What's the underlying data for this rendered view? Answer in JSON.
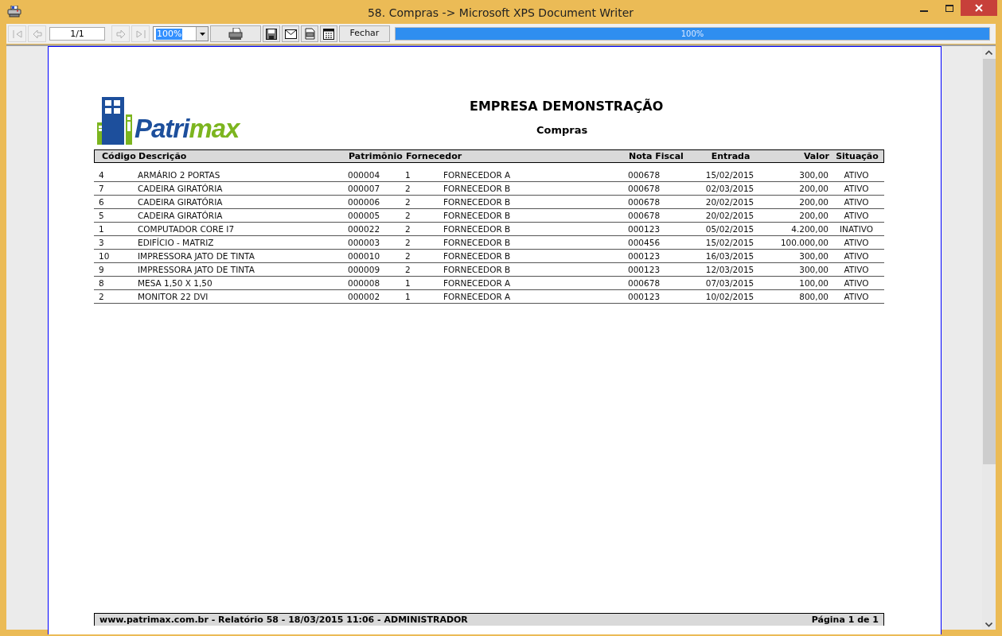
{
  "window": {
    "title": "58. Compras -> Microsoft XPS Document Writer"
  },
  "toolbar": {
    "nav_buttons": [
      {
        "kind": "first",
        "disabled": true
      },
      {
        "kind": "prev",
        "disabled": true
      }
    ],
    "page_field": "1/1",
    "nav_buttons_after": [
      {
        "kind": "next",
        "disabled": true
      },
      {
        "kind": "last",
        "disabled": true
      }
    ],
    "zoom": "100%",
    "close_button": "Fechar",
    "progress": {
      "level": 1,
      "label": "100%"
    }
  },
  "report": {
    "logo_text": [
      {
        "text": "Patri",
        "color": "#1d4f9c"
      },
      {
        "text": "max",
        "color": "#7cb51f"
      }
    ],
    "company": "EMPRESA DEMONSTRAÇÃO",
    "title": "Compras",
    "columns": [
      "Código",
      "Descrição",
      "Patrimônio",
      "Fornecedor",
      "Nota Fiscal",
      "Entrada",
      "Valor",
      "Situação"
    ],
    "rows": [
      {
        "codigo": "4",
        "descricao": "ARMÁRIO 2 PORTAS",
        "patrimonio": "000004",
        "fornecedor_codigo": "1",
        "fornecedor": "FORNECEDOR A",
        "nota_fiscal": "000678",
        "entrada": "15/02/2015",
        "valor": "300,00",
        "situacao": "ATIVO"
      },
      {
        "codigo": "7",
        "descricao": "CADEIRA GIRATÓRIA",
        "patrimonio": "000007",
        "fornecedor_codigo": "2",
        "fornecedor": "FORNECEDOR B",
        "nota_fiscal": "000678",
        "entrada": "02/03/2015",
        "valor": "200,00",
        "situacao": "ATIVO"
      },
      {
        "codigo": "6",
        "descricao": "CADEIRA GIRATÓRIA",
        "patrimonio": "000006",
        "fornecedor_codigo": "2",
        "fornecedor": "FORNECEDOR B",
        "nota_fiscal": "000678",
        "entrada": "20/02/2015",
        "valor": "200,00",
        "situacao": "ATIVO"
      },
      {
        "codigo": "5",
        "descricao": "CADEIRA GIRATÓRIA",
        "patrimonio": "000005",
        "fornecedor_codigo": "2",
        "fornecedor": "FORNECEDOR B",
        "nota_fiscal": "000678",
        "entrada": "20/02/2015",
        "valor": "200,00",
        "situacao": "ATIVO"
      },
      {
        "codigo": "1",
        "descricao": "COMPUTADOR CORE I7",
        "patrimonio": "000022",
        "fornecedor_codigo": "2",
        "fornecedor": "FORNECEDOR B",
        "nota_fiscal": "000123",
        "entrada": "05/02/2015",
        "valor": "4.200,00",
        "situacao": "INATIVO"
      },
      {
        "codigo": "3",
        "descricao": "EDIFÍCIO - MATRIZ",
        "patrimonio": "000003",
        "fornecedor_codigo": "2",
        "fornecedor": "FORNECEDOR B",
        "nota_fiscal": "000456",
        "entrada": "15/02/2015",
        "valor": "100.000,00",
        "situacao": "ATIVO"
      },
      {
        "codigo": "10",
        "descricao": "IMPRESSORA JATO DE TINTA",
        "patrimonio": "000010",
        "fornecedor_codigo": "2",
        "fornecedor": "FORNECEDOR B",
        "nota_fiscal": "000123",
        "entrada": "16/03/2015",
        "valor": "300,00",
        "situacao": "ATIVO"
      },
      {
        "codigo": "9",
        "descricao": "IMPRESSORA JATO DE TINTA",
        "patrimonio": "000009",
        "fornecedor_codigo": "2",
        "fornecedor": "FORNECEDOR B",
        "nota_fiscal": "000123",
        "entrada": "12/03/2015",
        "valor": "300,00",
        "situacao": "ATIVO"
      },
      {
        "codigo": "8",
        "descricao": "MESA 1,50 X 1,50",
        "patrimonio": "000008",
        "fornecedor_codigo": "1",
        "fornecedor": "FORNECEDOR A",
        "nota_fiscal": "000678",
        "entrada": "07/03/2015",
        "valor": "100,00",
        "situacao": "ATIVO"
      },
      {
        "codigo": "2",
        "descricao": "MONITOR 22 DVI",
        "patrimonio": "000002",
        "fornecedor_codigo": "1",
        "fornecedor": "FORNECEDOR A",
        "nota_fiscal": "000123",
        "entrada": "10/02/2015",
        "valor": "800,00",
        "situacao": "ATIVO"
      }
    ],
    "footer_left": "www.patrimax.com.br - Relatório 58 - 18/03/2015 11:06 - ADMINISTRADOR",
    "footer_right": "Página 1 de 1"
  }
}
